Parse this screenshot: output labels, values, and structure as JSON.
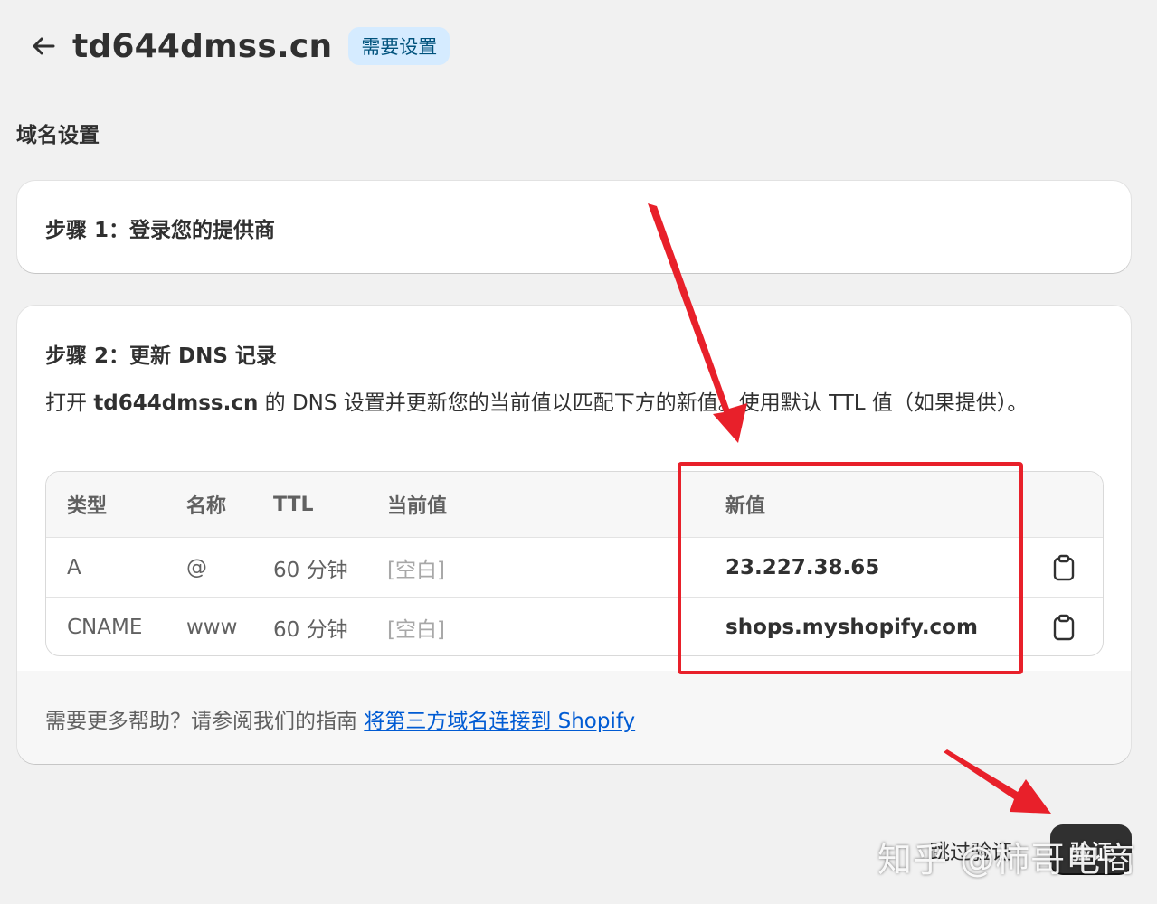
{
  "header": {
    "title": "td644dmss.cn",
    "badge": "需要设置",
    "back_icon": "arrow-left-icon"
  },
  "section_title": "域名设置",
  "step1": {
    "title": "步骤 1：登录您的提供商"
  },
  "step2": {
    "title": "步骤 2：更新 DNS 记录",
    "desc_prefix": "打开 ",
    "desc_domain": "td644dmss.cn",
    "desc_suffix": " 的 DNS 设置并更新您的当前值以匹配下方的新值。使用默认 TTL 值（如果提供）。",
    "table": {
      "headers": {
        "type": "类型",
        "name": "名称",
        "ttl": "TTL",
        "current": "当前值",
        "new": "新值"
      },
      "rows": [
        {
          "type": "A",
          "name": "@",
          "ttl": "60 分钟",
          "current": "[空白]",
          "new": "23.227.38.65",
          "copy_icon": "clipboard-icon"
        },
        {
          "type": "CNAME",
          "name": "www",
          "ttl": "60 分钟",
          "current": "[空白]",
          "new": "shops.myshopify.com",
          "copy_icon": "clipboard-icon"
        }
      ]
    },
    "help_text": "需要更多帮助？请参阅我们的指南 ",
    "help_link": "将第三方域名连接到 Shopify"
  },
  "actions": {
    "skip": "跳过验证",
    "verify": "验证"
  },
  "watermark": "知乎 @柿哥电商",
  "colors": {
    "annotation_red": "#e8202a",
    "link": "#005bd3",
    "badge_bg": "#d5ebff",
    "primary_button": "#303030"
  }
}
